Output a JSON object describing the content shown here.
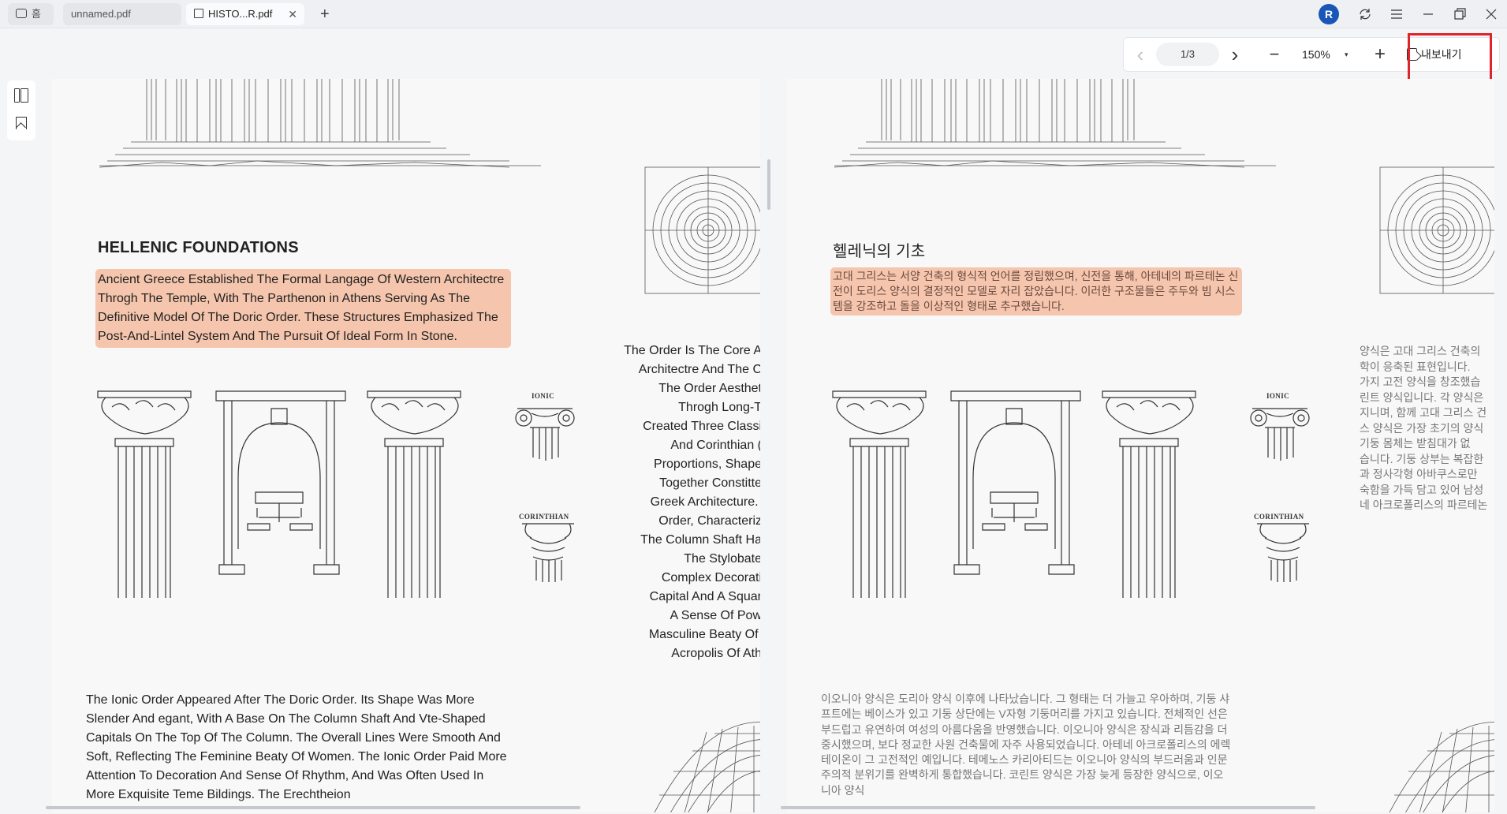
{
  "titlebar": {
    "home_tab": "홈",
    "tab1": "unnamed.pdf",
    "tab2": "HISTO...R.pdf",
    "close": "✕",
    "new_tab": "+",
    "avatar": "R"
  },
  "toolbar": {
    "prev": "‹",
    "page_indicator": "1/3",
    "next": "›",
    "zoom_out": "−",
    "zoom_value": "150%",
    "zoom_dropdown": "▾",
    "zoom_in": "+",
    "export_label": "내보내기"
  },
  "left_page": {
    "heading": "HELLENIC FOUNDATIONS",
    "highlighted": "Ancient Greece Established The Formal Lang​age Of Western Architect​re Thro​gh The Temple, With The Parthenon in Athens Serving As The Definitive Model Of The Doric Order. These Structures Emphasized The Post-And-Lintel System And The Pursuit Of Ideal Form In Stone.",
    "column_lines": "The Order Is The Core A\nArchitect​re And The C\nThe Order Aesthet\nThro​gh Long-T\nCreated Three Classi\nAnd Corinthian (\nProportions, Shape\nTogether Constit​te\nGreek Architecture. \nOrder, Characteriz\nThe Column Shaft Ha\nThe Stylobate\nComplex Decorati\nCapital And A Squar\nA Sense Of Pow\nMasculine Bea​ty Of \nAcropolis Of Ath",
    "body": "The Ionic Order Appeared After The Doric Order. Its Shape Was More Slender And ​egant, With A Base On The Column Shaft And V​te-Shaped Capitals On The Top Of The Column. The Overall Lines Were Smooth And Soft, Reflecting The Feminine Bea​ty Of Women. The Ionic Order Paid More Attention To Decoration And Sense Of Rhythm, And Was Often Used In More Exquisite Tem​e B​ildings. The Erechtheion",
    "ionic_label": "IONIC",
    "corinthian_label": "CORINTHIAN"
  },
  "right_page": {
    "heading": "헬레닉의 기초",
    "highlighted": "고대 그리스는 서양 건축의 형식적 언어를 정립했으며, 신전을 통해, 아테네의 파르테논 신전이 도리스 양식의 결정적인 모델로 자리 잡았습니다. 이러한 구조물들은 주두와 빔 시스템을 강조하고 돌을 이상적인 형태로 추구했습니다.",
    "column_lines": "양식은 고대 그리스 건축의\n학이 응축된 표현입니다.\n가지 고전 양식을 창조했습\n린트 양식입니다. 각 양식은\n지니며, 함께 고대 그리스 건\n스 양식은 가장 초기의 양식\n기둥 몸체는 받침대가 없\n습니다. 기둥 상부는 복잡한\n과 정사각형 아바쿠스로만\n숙함을 가득 담고 있어 남성\n네 아크로폴리스의 파르테논",
    "body": "이오니아 양식은 도리아 양식 이후에 나타났습니다. 그 형태는 더 가늘고 우아하며, 기둥 샤프트에는 베이스가 있고 기둥 상단에는 V자형 기둥머리를 가지고 있습니다. 전체적인 선은 부드럽고 유연하여 여성의 아름다움을 반영했습니다. 이오니아 양식은 장식과 리듬감을 더 중시했으며, 보다 정교한 사원 건축물에 자주 사용되었습니다. 아테네 아크로폴리스의 에렉테이온이 그 고전적인 예입니다. 테메노스 카리아티드는 이오니아 양식의 부드러움과 인문주의적 분위기를 완벽하게 통합했습니다. 코린트 양식은 가장 늦게 등장한 양식으로, 이오니아 양식",
    "ionic_label": "IONIC",
    "corinthian_label": "CORINTHIAN"
  },
  "icons": {
    "home": "home-icon",
    "pdf": "pdf-icon",
    "sync": "sync-icon",
    "menu": "menu-icon",
    "minimize": "minimize-icon",
    "restore": "restore-icon",
    "close": "close-icon",
    "thumbnails": "thumbnails-icon",
    "bookmark": "bookmark-icon",
    "export": "export-icon"
  },
  "colors": {
    "highlight": "#f5c6ad",
    "export_outline": "#e0242c",
    "avatar": "#1a56b8"
  }
}
